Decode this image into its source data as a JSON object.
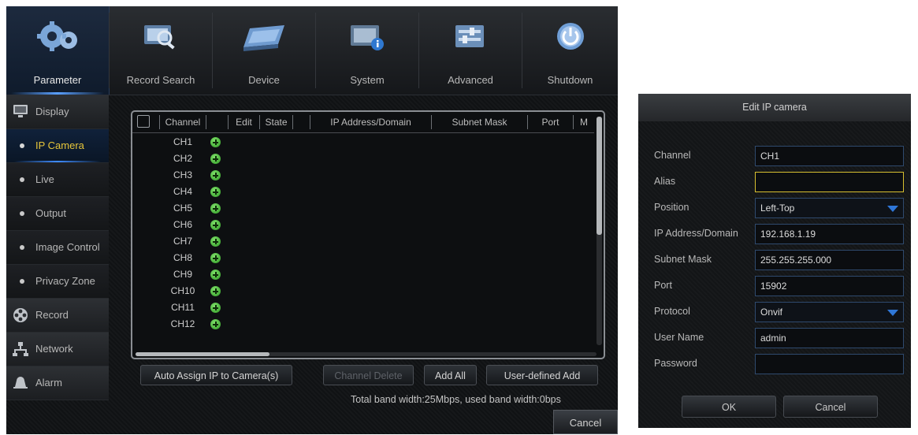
{
  "menu": {
    "items": [
      {
        "label": "Parameter",
        "icon": "gears-icon"
      },
      {
        "label": "Record Search",
        "icon": "record-search-icon"
      },
      {
        "label": "Device",
        "icon": "hard-drive-icon"
      },
      {
        "label": "System",
        "icon": "system-info-icon"
      },
      {
        "label": "Advanced",
        "icon": "advanced-settings-icon"
      },
      {
        "label": "Shutdown",
        "icon": "power-icon"
      }
    ],
    "active": "Parameter"
  },
  "sidebar": {
    "items": [
      {
        "label": "Display"
      },
      {
        "label": "IP Camera"
      },
      {
        "label": "Live"
      },
      {
        "label": "Output"
      },
      {
        "label": "Image Control"
      },
      {
        "label": "Privacy Zone"
      },
      {
        "label": "Record"
      },
      {
        "label": "Network"
      },
      {
        "label": "Alarm"
      }
    ],
    "active": "IP Camera"
  },
  "table": {
    "columns": [
      "Channel",
      "",
      "Edit",
      "State",
      "",
      "IP Address/Domain",
      "Subnet Mask",
      "Port",
      "M"
    ],
    "rows": [
      "CH1",
      "CH2",
      "CH3",
      "CH4",
      "CH5",
      "CH6",
      "CH7",
      "CH8",
      "CH9",
      "CH10",
      "CH11",
      "CH12"
    ]
  },
  "buttons": {
    "auto_assign": "Auto Assign IP to Camera(s)",
    "channel_delete": "Channel Delete",
    "add_all": "Add All",
    "user_defined_add": "User-defined Add",
    "cancel": "Cancel"
  },
  "bandwidth": "Total band width:25Mbps, used band width:0bps",
  "dialog": {
    "title": "Edit IP camera",
    "fields": {
      "channel": {
        "label": "Channel",
        "value": "CH1"
      },
      "alias": {
        "label": "Alias",
        "value": ""
      },
      "position": {
        "label": "Position",
        "value": "Left-Top"
      },
      "ip": {
        "label": "IP Address/Domain",
        "value": "192.168.1.19"
      },
      "mask": {
        "label": "Subnet Mask",
        "value": "255.255.255.000"
      },
      "port": {
        "label": "Port",
        "value": "15902"
      },
      "protocol": {
        "label": "Protocol",
        "value": "Onvif"
      },
      "user": {
        "label": "User Name",
        "value": "admin"
      },
      "password": {
        "label": "Password",
        "value": ""
      }
    },
    "ok": "OK",
    "cancel": "Cancel"
  },
  "colors": {
    "accent": "#3f8cff",
    "active_text": "#e6c53a",
    "add_icon": "#3fae2e",
    "dropdown_arrow": "#2f77d8"
  }
}
